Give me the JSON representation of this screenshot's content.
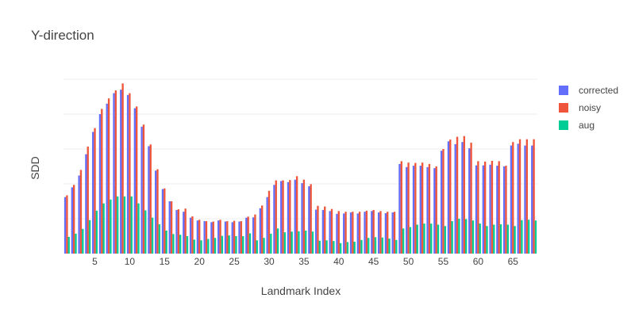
{
  "chart_data": {
    "type": "bar",
    "title": "Y-direction",
    "xlabel": "Landmark Index",
    "ylabel": "SDD",
    "x": [
      1,
      2,
      3,
      4,
      5,
      6,
      7,
      8,
      9,
      10,
      11,
      12,
      13,
      14,
      15,
      16,
      17,
      18,
      19,
      20,
      21,
      22,
      23,
      24,
      25,
      26,
      27,
      28,
      29,
      30,
      31,
      32,
      33,
      34,
      35,
      36,
      37,
      38,
      39,
      40,
      41,
      42,
      43,
      44,
      45,
      46,
      47,
      48,
      49,
      50,
      51,
      52,
      53,
      54,
      55,
      56,
      57,
      58,
      59,
      60,
      61,
      62,
      63,
      64,
      65,
      66,
      67,
      68
    ],
    "xticks": [
      5,
      10,
      15,
      20,
      25,
      30,
      35,
      40,
      45,
      50,
      55,
      60,
      65
    ],
    "xlim": [
      0.5,
      68.5
    ],
    "ylim": [
      0,
      5
    ],
    "grid": true,
    "legend_position": "top-right",
    "series": [
      {
        "name": "corrected",
        "color": "#636efa",
        "values": [
          1.62,
          1.9,
          2.24,
          2.85,
          3.49,
          4.0,
          4.3,
          4.6,
          4.7,
          4.55,
          4.17,
          3.64,
          3.08,
          2.38,
          1.85,
          1.5,
          1.25,
          1.2,
          1.03,
          0.95,
          0.93,
          0.9,
          0.95,
          0.92,
          0.9,
          0.92,
          1.03,
          1.04,
          1.3,
          1.62,
          1.97,
          2.08,
          2.05,
          2.12,
          2.02,
          1.93,
          1.26,
          1.25,
          1.22,
          1.14,
          1.15,
          1.18,
          1.15,
          1.2,
          1.22,
          1.18,
          1.16,
          1.18,
          2.57,
          2.48,
          2.52,
          2.52,
          2.48,
          2.45,
          2.95,
          3.22,
          3.14,
          3.2,
          3.02,
          2.53,
          2.53,
          2.55,
          2.52,
          2.5,
          3.1,
          3.15,
          3.1,
          3.1
        ]
      },
      {
        "name": "noisy",
        "color": "#ef553b",
        "values": [
          1.67,
          1.97,
          2.4,
          3.07,
          3.6,
          4.15,
          4.45,
          4.68,
          4.88,
          4.6,
          4.22,
          3.7,
          3.13,
          2.42,
          1.87,
          1.5,
          1.27,
          1.29,
          1.07,
          0.97,
          0.93,
          0.92,
          0.97,
          0.93,
          0.94,
          0.93,
          1.06,
          1.12,
          1.38,
          1.8,
          2.1,
          2.1,
          2.11,
          2.22,
          2.12,
          1.99,
          1.37,
          1.35,
          1.28,
          1.22,
          1.2,
          1.2,
          1.2,
          1.23,
          1.25,
          1.22,
          1.2,
          1.2,
          2.65,
          2.61,
          2.6,
          2.61,
          2.57,
          2.5,
          3.0,
          3.27,
          3.35,
          3.37,
          3.18,
          2.65,
          2.64,
          2.66,
          2.65,
          2.52,
          3.2,
          3.28,
          3.28,
          3.28
        ]
      },
      {
        "name": "aug",
        "color": "#00cc96",
        "values": [
          0.48,
          0.57,
          0.71,
          0.96,
          1.23,
          1.44,
          1.55,
          1.64,
          1.64,
          1.64,
          1.44,
          1.24,
          1.03,
          0.84,
          0.66,
          0.56,
          0.54,
          0.5,
          0.4,
          0.38,
          0.42,
          0.45,
          0.51,
          0.52,
          0.5,
          0.5,
          0.58,
          0.38,
          0.45,
          0.57,
          0.72,
          0.61,
          0.63,
          0.64,
          0.66,
          0.63,
          0.37,
          0.38,
          0.36,
          0.3,
          0.33,
          0.34,
          0.39,
          0.45,
          0.47,
          0.46,
          0.43,
          0.39,
          0.72,
          0.76,
          0.83,
          0.86,
          0.86,
          0.83,
          0.79,
          0.93,
          1.0,
          0.99,
          0.95,
          0.86,
          0.79,
          0.83,
          0.84,
          0.83,
          0.79,
          0.96,
          0.97,
          0.95
        ]
      }
    ]
  }
}
